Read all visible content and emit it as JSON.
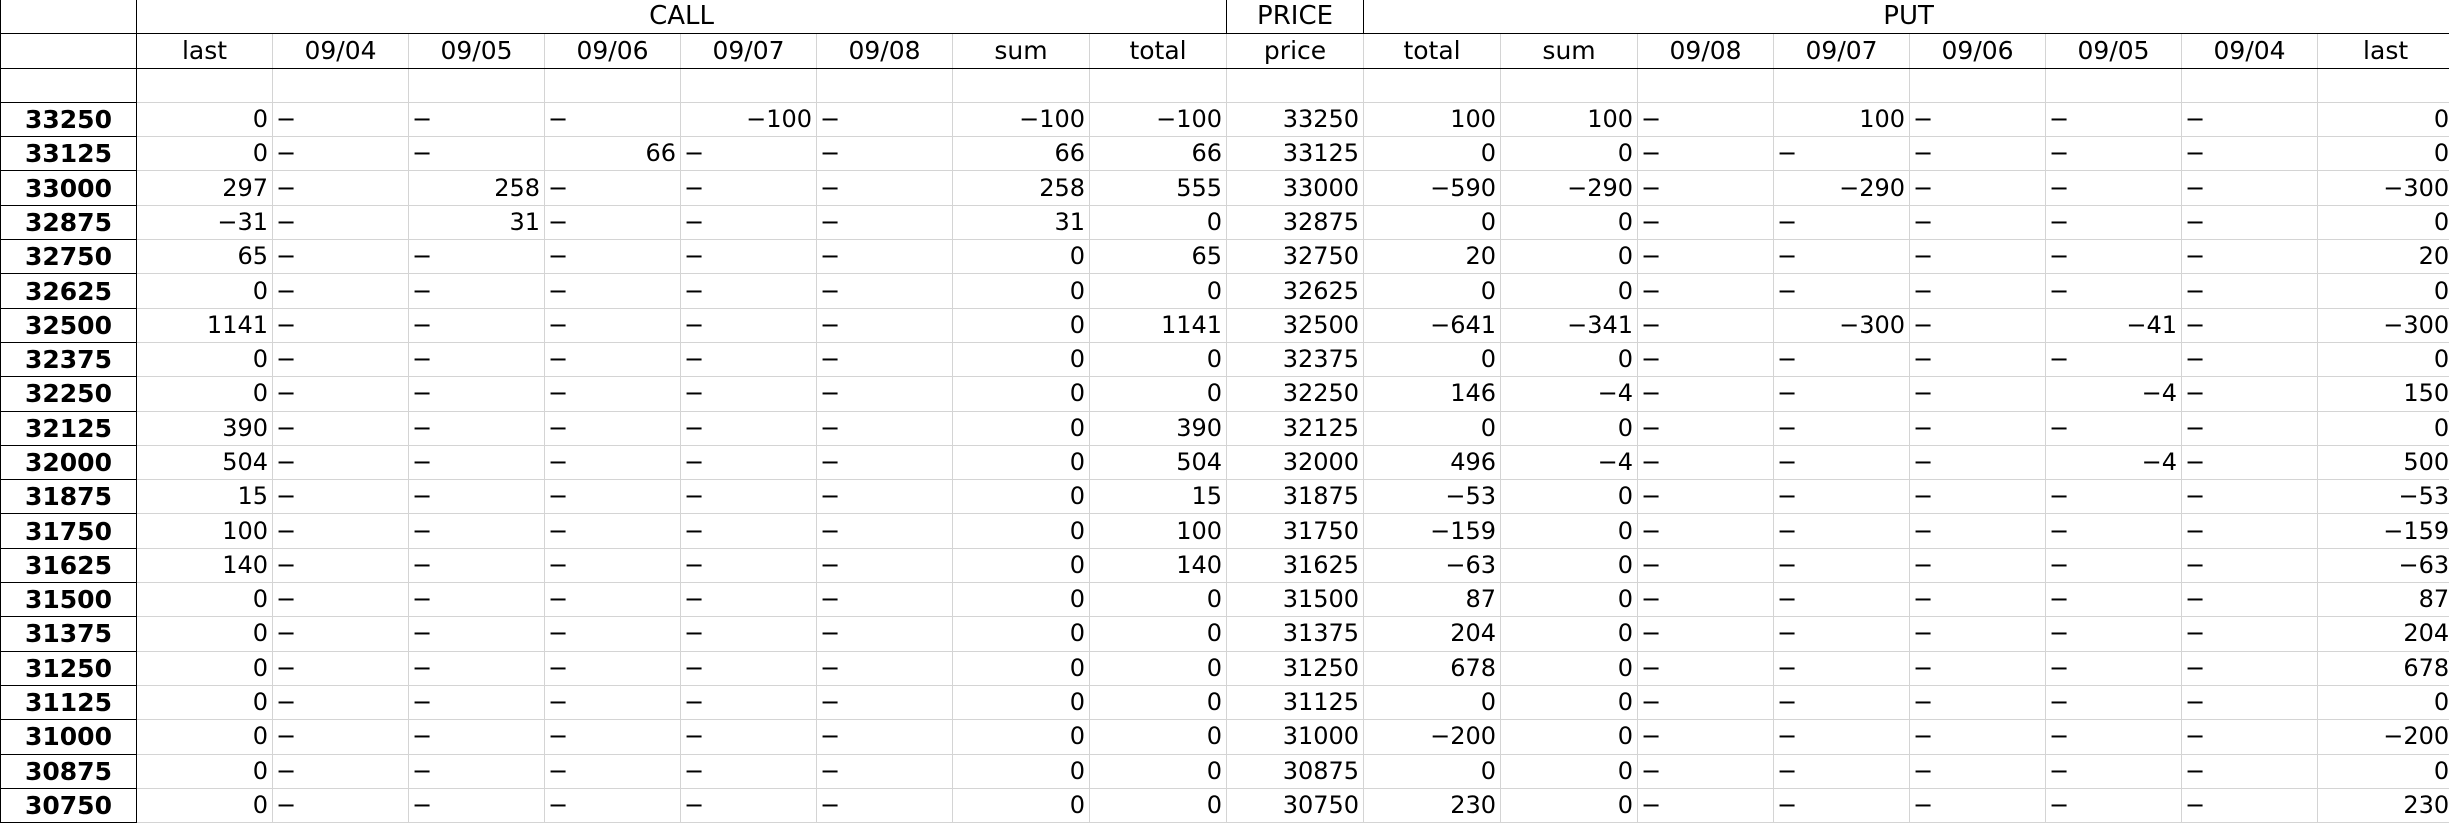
{
  "headers": {
    "groups": {
      "call": "CALL",
      "price": "PRICE",
      "put": "PUT"
    },
    "columns": [
      "last",
      "09/04",
      "09/05",
      "09/06",
      "09/07",
      "09/08",
      "sum",
      "total",
      "price",
      "total",
      "sum",
      "09/08",
      "09/07",
      "09/06",
      "09/05",
      "09/04",
      "last"
    ]
  },
  "rows": [
    {
      "label": "33250",
      "cells": [
        "0",
        "−",
        "−",
        "−",
        "−100",
        "−",
        "−100",
        "−100",
        "33250",
        "100",
        "100",
        "−",
        "100",
        "−",
        "−",
        "−",
        "0"
      ]
    },
    {
      "label": "33125",
      "cells": [
        "0",
        "−",
        "−",
        "66",
        "−",
        "−",
        "66",
        "66",
        "33125",
        "0",
        "0",
        "−",
        "−",
        "−",
        "−",
        "−",
        "0"
      ]
    },
    {
      "label": "33000",
      "cells": [
        "297",
        "−",
        "258",
        "−",
        "−",
        "−",
        "258",
        "555",
        "33000",
        "−590",
        "−290",
        "−",
        "−290",
        "−",
        "−",
        "−",
        "−300"
      ]
    },
    {
      "label": "32875",
      "cells": [
        "−31",
        "−",
        "31",
        "−",
        "−",
        "−",
        "31",
        "0",
        "32875",
        "0",
        "0",
        "−",
        "−",
        "−",
        "−",
        "−",
        "0"
      ]
    },
    {
      "label": "32750",
      "cells": [
        "65",
        "−",
        "−",
        "−",
        "−",
        "−",
        "0",
        "65",
        "32750",
        "20",
        "0",
        "−",
        "−",
        "−",
        "−",
        "−",
        "20"
      ]
    },
    {
      "label": "32625",
      "cells": [
        "0",
        "−",
        "−",
        "−",
        "−",
        "−",
        "0",
        "0",
        "32625",
        "0",
        "0",
        "−",
        "−",
        "−",
        "−",
        "−",
        "0"
      ]
    },
    {
      "label": "32500",
      "cells": [
        "1141",
        "−",
        "−",
        "−",
        "−",
        "−",
        "0",
        "1141",
        "32500",
        "−641",
        "−341",
        "−",
        "−300",
        "−",
        "−41",
        "−",
        "−300"
      ]
    },
    {
      "label": "32375",
      "cells": [
        "0",
        "−",
        "−",
        "−",
        "−",
        "−",
        "0",
        "0",
        "32375",
        "0",
        "0",
        "−",
        "−",
        "−",
        "−",
        "−",
        "0"
      ]
    },
    {
      "label": "32250",
      "cells": [
        "0",
        "−",
        "−",
        "−",
        "−",
        "−",
        "0",
        "0",
        "32250",
        "146",
        "−4",
        "−",
        "−",
        "−",
        "−4",
        "−",
        "150"
      ]
    },
    {
      "label": "32125",
      "cells": [
        "390",
        "−",
        "−",
        "−",
        "−",
        "−",
        "0",
        "390",
        "32125",
        "0",
        "0",
        "−",
        "−",
        "−",
        "−",
        "−",
        "0"
      ]
    },
    {
      "label": "32000",
      "cells": [
        "504",
        "−",
        "−",
        "−",
        "−",
        "−",
        "0",
        "504",
        "32000",
        "496",
        "−4",
        "−",
        "−",
        "−",
        "−4",
        "−",
        "500"
      ]
    },
    {
      "label": "31875",
      "cells": [
        "15",
        "−",
        "−",
        "−",
        "−",
        "−",
        "0",
        "15",
        "31875",
        "−53",
        "0",
        "−",
        "−",
        "−",
        "−",
        "−",
        "−53"
      ]
    },
    {
      "label": "31750",
      "cells": [
        "100",
        "−",
        "−",
        "−",
        "−",
        "−",
        "0",
        "100",
        "31750",
        "−159",
        "0",
        "−",
        "−",
        "−",
        "−",
        "−",
        "−159"
      ]
    },
    {
      "label": "31625",
      "cells": [
        "140",
        "−",
        "−",
        "−",
        "−",
        "−",
        "0",
        "140",
        "31625",
        "−63",
        "0",
        "−",
        "−",
        "−",
        "−",
        "−",
        "−63"
      ]
    },
    {
      "label": "31500",
      "cells": [
        "0",
        "−",
        "−",
        "−",
        "−",
        "−",
        "0",
        "0",
        "31500",
        "87",
        "0",
        "−",
        "−",
        "−",
        "−",
        "−",
        "87"
      ]
    },
    {
      "label": "31375",
      "cells": [
        "0",
        "−",
        "−",
        "−",
        "−",
        "−",
        "0",
        "0",
        "31375",
        "204",
        "0",
        "−",
        "−",
        "−",
        "−",
        "−",
        "204"
      ]
    },
    {
      "label": "31250",
      "cells": [
        "0",
        "−",
        "−",
        "−",
        "−",
        "−",
        "0",
        "0",
        "31250",
        "678",
        "0",
        "−",
        "−",
        "−",
        "−",
        "−",
        "678"
      ]
    },
    {
      "label": "31125",
      "cells": [
        "0",
        "−",
        "−",
        "−",
        "−",
        "−",
        "0",
        "0",
        "31125",
        "0",
        "0",
        "−",
        "−",
        "−",
        "−",
        "−",
        "0"
      ]
    },
    {
      "label": "31000",
      "cells": [
        "0",
        "−",
        "−",
        "−",
        "−",
        "−",
        "0",
        "0",
        "31000",
        "−200",
        "0",
        "−",
        "−",
        "−",
        "−",
        "−",
        "−200"
      ]
    },
    {
      "label": "30875",
      "cells": [
        "0",
        "−",
        "−",
        "−",
        "−",
        "−",
        "0",
        "0",
        "30875",
        "0",
        "0",
        "−",
        "−",
        "−",
        "−",
        "−",
        "0"
      ]
    },
    {
      "label": "30750",
      "cells": [
        "0",
        "−",
        "−",
        "−",
        "−",
        "−",
        "0",
        "0",
        "30750",
        "230",
        "0",
        "−",
        "−",
        "−",
        "−",
        "−",
        "230"
      ]
    }
  ]
}
